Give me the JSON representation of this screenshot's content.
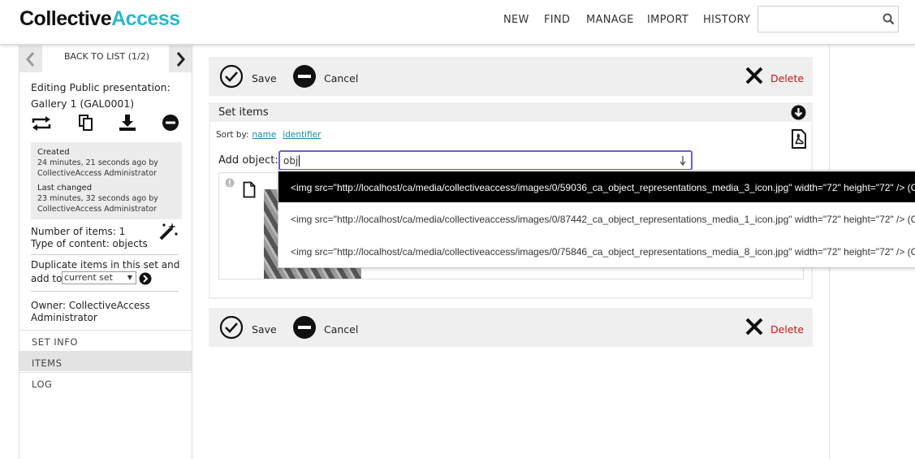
{
  "app": {
    "logo_part1": "Collective",
    "logo_part2": "Access",
    "nav": [
      "NEW",
      "FIND",
      "MANAGE",
      "IMPORT",
      "HISTORY"
    ],
    "search_value": ""
  },
  "sidebar": {
    "back_label": "BACK TO LIST (1/2)",
    "editing_line1": "Editing Public presentation:",
    "editing_line2": "Gallery 1 (GAL0001)",
    "meta": {
      "created_label": "Created",
      "created_value1": "24 minutes, 21 seconds ago by",
      "created_value2": "CollectiveAccess Administrator",
      "changed_label": "Last changed",
      "changed_value1": "23 minutes, 32 seconds ago by",
      "changed_value2": "CollectiveAccess Administrator"
    },
    "num_items": "Number of items: 1",
    "content_type": "Type of content: objects",
    "duplicate_line1": "Duplicate items in this set and",
    "duplicate_line2": "add to",
    "duplicate_select": "current set",
    "owner_line1": "Owner: CollectiveAccess",
    "owner_line2": "Administrator",
    "nav_items": [
      "SET INFO",
      "ITEMS",
      "LOG"
    ],
    "active_nav": "ITEMS"
  },
  "toolbar": {
    "save": "Save",
    "cancel": "Cancel",
    "delete": "Delete"
  },
  "panel": {
    "title": "Set items",
    "sort_by": "Sort by:",
    "sort_name": "name",
    "sort_identifier": "identifier",
    "add_object_label": "Add object:",
    "add_object_value": "obj"
  },
  "autocomplete": [
    "<img src=\"http://localhost/ca/media/collectiveaccess/images/0/59036_ca_object_representations_media_3_icon.jpg\" width=\"72\" height=\"72\" /> (C",
    "<img src=\"http://localhost/ca/media/collectiveaccess/images/0/87442_ca_object_representations_media_1_icon.jpg\" width=\"72\" height=\"72\" /> (C",
    "<img src=\"http://localhost/ca/media/collectiveaccess/images/0/75846_ca_object_representations_media_8_icon.jpg\" width=\"72\" height=\"72\" /> (C"
  ],
  "colors": {
    "accent": "#29b8cc",
    "delete": "#c81414",
    "link": "#1a8aa3"
  }
}
